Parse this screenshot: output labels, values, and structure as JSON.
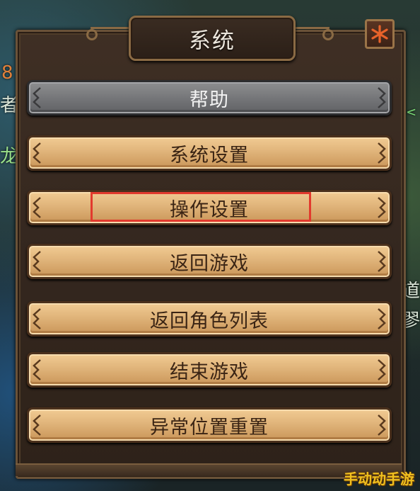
{
  "background": {
    "left_texts": [
      "8",
      "者",
      "龙"
    ],
    "right_texts": [
      "道",
      "翏"
    ]
  },
  "window": {
    "title": "系统",
    "close_icon": "asterisk-close-icon"
  },
  "menu": {
    "items": [
      {
        "label": "帮助",
        "state": "disabled"
      },
      {
        "label": "系统设置",
        "state": "normal"
      },
      {
        "label": "操作设置",
        "state": "highlighted"
      },
      {
        "label": "返回游戏",
        "state": "normal"
      },
      {
        "label": "返回角色列表",
        "state": "normal"
      },
      {
        "label": "结束游戏",
        "state": "normal"
      },
      {
        "label": "异常位置重置",
        "state": "normal"
      }
    ]
  },
  "watermark": "手动动手游",
  "colors": {
    "button_gold": "#e0b47a",
    "button_gray": "#76777a",
    "highlight_red": "#e23a2e",
    "panel_brown": "#3f2f24",
    "watermark_yellow": "#f0c020"
  }
}
